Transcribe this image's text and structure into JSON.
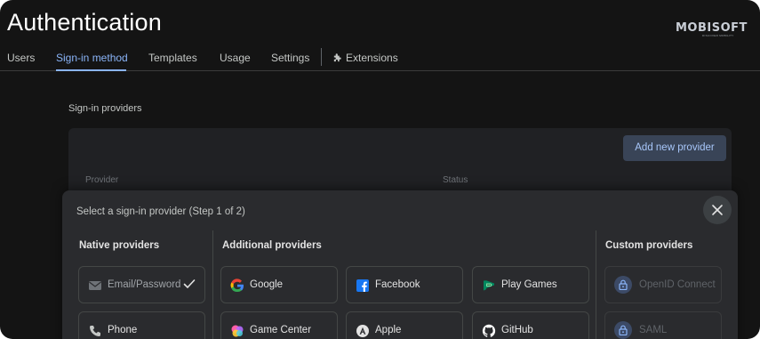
{
  "header": {
    "title": "Authentication",
    "logo_text": "MOBISOFT",
    "logo_sub": "DISCOVER MOBILITY"
  },
  "tabs": [
    {
      "label": "Users",
      "active": false
    },
    {
      "label": "Sign-in method",
      "active": true
    },
    {
      "label": "Templates",
      "active": false
    },
    {
      "label": "Usage",
      "active": false
    },
    {
      "label": "Settings",
      "active": false
    },
    {
      "label": "Extensions",
      "active": false
    }
  ],
  "providers_section": {
    "title": "Sign-in providers",
    "add_button": "Add new provider",
    "col_provider": "Provider",
    "col_status": "Status"
  },
  "modal": {
    "title": "Select a sign-in provider (Step 1 of 2)",
    "native": {
      "title": "Native providers",
      "items": [
        {
          "label": "Email/Password",
          "icon": "email-icon",
          "enabled": true
        },
        {
          "label": "Phone",
          "icon": "phone-icon"
        }
      ]
    },
    "additional": {
      "title": "Additional providers",
      "items": [
        {
          "label": "Google",
          "icon": "google-icon"
        },
        {
          "label": "Facebook",
          "icon": "facebook-icon"
        },
        {
          "label": "Play Games",
          "icon": "play-games-icon"
        },
        {
          "label": "Game Center",
          "icon": "game-center-icon"
        },
        {
          "label": "Apple",
          "icon": "apple-icon"
        },
        {
          "label": "GitHub",
          "icon": "github-icon"
        }
      ]
    },
    "custom": {
      "title": "Custom providers",
      "items": [
        {
          "label": "OpenID Connect",
          "icon": "lock-icon",
          "disabled": true
        },
        {
          "label": "SAML",
          "icon": "lock-icon",
          "disabled": true
        }
      ]
    }
  },
  "colors": {
    "background": "#141414",
    "accent": "#8ab4f8",
    "card": "#202124",
    "modal": "#2a2b2e"
  }
}
